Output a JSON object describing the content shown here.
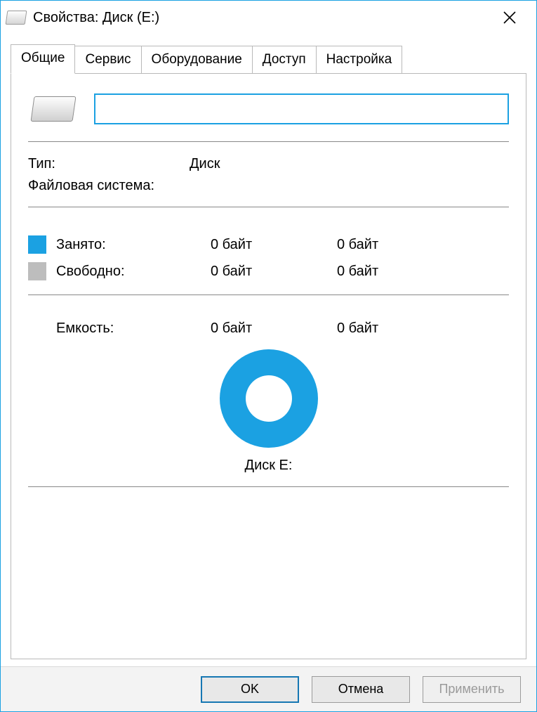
{
  "window": {
    "title": "Свойства: Диск (E:)"
  },
  "tabs": [
    {
      "label": "Общие"
    },
    {
      "label": "Сервис"
    },
    {
      "label": "Оборудование"
    },
    {
      "label": "Доступ"
    },
    {
      "label": "Настройка"
    }
  ],
  "name_field": {
    "value": ""
  },
  "props": {
    "type_label": "Тип:",
    "type_value": "Диск",
    "fs_label": "Файловая система:",
    "fs_value": ""
  },
  "usage": {
    "used_label": "Занято:",
    "used_bytes": "0 байт",
    "used_human": "0 байт",
    "free_label": "Свободно:",
    "free_bytes": "0 байт",
    "free_human": "0 байт",
    "cap_label": "Емкость:",
    "cap_bytes": "0 байт",
    "cap_human": "0 байт"
  },
  "colors": {
    "used": "#1ba1e2",
    "free": "#bdbdbd"
  },
  "drive_caption": "Диск E:",
  "buttons": {
    "ok": "OK",
    "cancel": "Отмена",
    "apply": "Применить"
  },
  "chart_data": {
    "type": "pie",
    "title": "Диск E:",
    "series": [
      {
        "name": "Занято",
        "value": 0,
        "color": "#1ba1e2"
      },
      {
        "name": "Свободно",
        "value": 0,
        "color": "#bdbdbd"
      }
    ]
  }
}
